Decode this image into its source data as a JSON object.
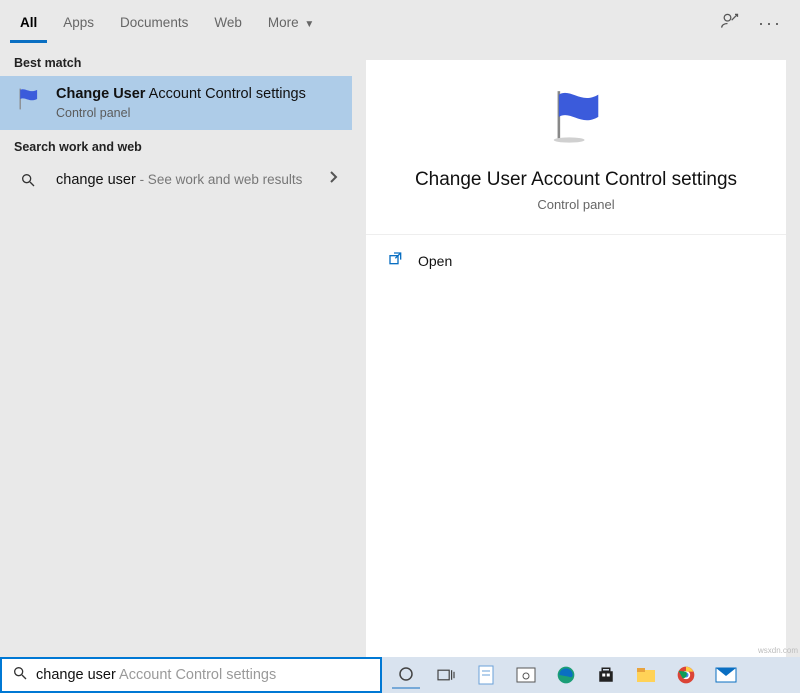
{
  "tabs": {
    "all": "All",
    "apps": "Apps",
    "documents": "Documents",
    "web": "Web",
    "more": "More"
  },
  "sections": {
    "best_match": "Best match",
    "search_work_web": "Search work and web"
  },
  "best_result": {
    "title_bold": "Change User",
    "title_rest": " Account Control settings",
    "subtitle": "Control panel"
  },
  "web_result": {
    "query": "change user",
    "suffix": " - See work and web results"
  },
  "detail": {
    "title": "Change User Account Control settings",
    "subtitle": "Control panel",
    "open": "Open"
  },
  "search": {
    "typed": "change user",
    "hint": " Account Control settings"
  },
  "watermark": "wsxdn.com"
}
